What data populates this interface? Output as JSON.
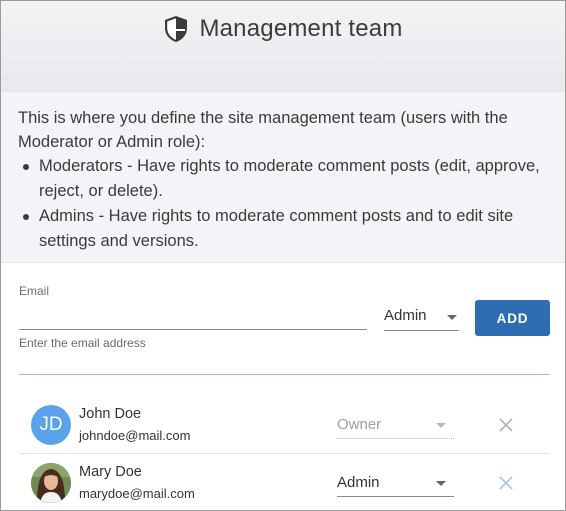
{
  "header": {
    "title": "Management team",
    "icon": "shield-icon"
  },
  "description": {
    "intro": "This is where you define the site management team (users with the Moderator or Admin role):",
    "items": [
      "Moderators - Have rights to moderate comment posts (edit, approve, reject, or delete).",
      "Admins - Have rights to moderate comment posts and to edit site settings and versions."
    ]
  },
  "add_form": {
    "email_label": "Email",
    "email_value": "",
    "helper_text": "Enter the email address",
    "role_value": "Admin",
    "add_label": "ADD"
  },
  "users": [
    {
      "initials": "JD",
      "name": "John Doe",
      "email": "johndoe@mail.com",
      "role": "Owner",
      "role_disabled": true
    },
    {
      "initials": "",
      "name": "Mary Doe",
      "email": "marydoe@mail.com",
      "role": "Admin",
      "role_disabled": false
    }
  ],
  "colors": {
    "accent": "#2f6db2",
    "avatar_jd": "#5aa2ea",
    "remove_icon": "#b0b0b0",
    "remove_icon_active": "#a8c4e2"
  }
}
